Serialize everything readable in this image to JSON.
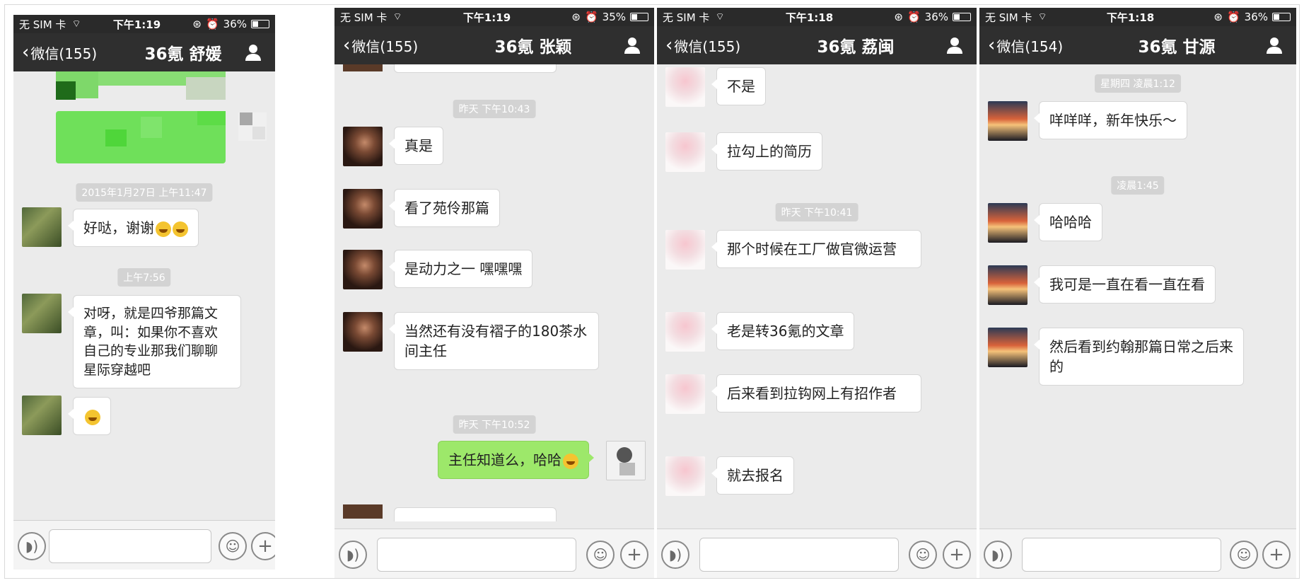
{
  "colors": {
    "bubble_green": "#9de86a",
    "navbar": "#2f2f2f",
    "statusbar": "#2a2a2a",
    "chat_bg": "#ebebeb"
  },
  "phones": [
    {
      "status": {
        "carrier": "无 SIM 卡",
        "time": "下午1:19",
        "battery": "36%"
      },
      "nav": {
        "back": "微信(155)",
        "title": "36氪 舒媛"
      },
      "timestamps": [
        "2015年1月27日 上午11:47",
        "上午7:56"
      ],
      "messages": [
        "好哒，谢谢",
        "对呀，就是四爷那篇文章，叫：如果你不喜欢自己的专业那我们聊聊星际穿越吧"
      ]
    },
    {
      "status": {
        "carrier": "无 SIM 卡",
        "time": "下午1:19",
        "battery": "35%"
      },
      "nav": {
        "back": "微信(155)",
        "title": "36氪 张颖"
      },
      "timestamps": [
        "昨天 下午10:43",
        "昨天 下午10:52"
      ],
      "messages": [
        "真是",
        "看了苑伶那篇",
        "是动力之一 嘿嘿嘿",
        "当然还有没有褶子的180茶水间主任",
        "主任知道么，哈哈"
      ]
    },
    {
      "status": {
        "carrier": "无 SIM 卡",
        "time": "下午1:18",
        "battery": "36%"
      },
      "nav": {
        "back": "微信(155)",
        "title": "36氪 荔闽"
      },
      "timestamps": [
        "昨天 下午10:41"
      ],
      "messages": [
        "不是",
        "拉勾上的简历",
        "那个时候在工厂做官微运营",
        "老是转36氪的文章",
        "后来看到拉钩网上有招作者",
        "就去报名"
      ]
    },
    {
      "status": {
        "carrier": "无 SIM 卡",
        "time": "下午1:18",
        "battery": "36%"
      },
      "nav": {
        "back": "微信(154)",
        "title": "36氪 甘源"
      },
      "timestamps": [
        "星期四 凌晨1:12",
        "凌晨1:45"
      ],
      "messages": [
        "咩咩咩，新年快乐～",
        "哈哈哈",
        "我可是一直在看一直在看",
        "然后看到约翰那篇日常之后来的"
      ]
    }
  ]
}
